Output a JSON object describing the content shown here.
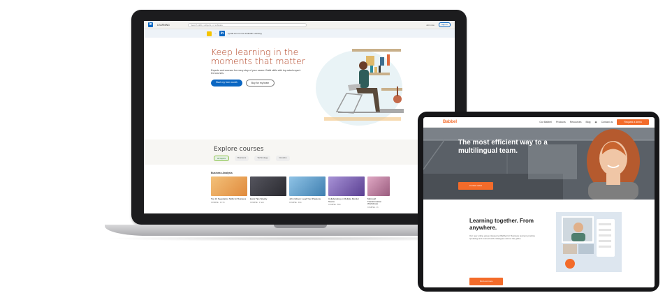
{
  "laptop": {
    "site": {
      "brand": "LEARNING",
      "search_placeholder": "Search skills, subjects, or software",
      "signin": "Sign in",
      "join_now": "Join now",
      "banner": "Lynda.com is now LinkedIn Learning"
    },
    "hero": {
      "headline": "Keep learning in the moments that matter",
      "sub": "Experts and courses for every step of your career. Build skills with top-rated expert-led courses.",
      "primary_btn": "Start my free month",
      "secondary_btn": "Buy for my team"
    },
    "explore": {
      "title": "Explore courses",
      "tabs": [
        "All topics",
        "Business",
        "Technology",
        "Creative"
      ],
      "section": "Business Analysis",
      "cards": [
        {
          "title": "Top 10 Negotiation Skills for Business",
          "meta": "COURSE · 1h 7m",
          "color": "#e08a3c"
        },
        {
          "title": "Excel Tips Weekly",
          "meta": "COURSE · 1 hour",
          "color": "#3d3d45"
        },
        {
          "title": "John Gibson: Lead Your Passions",
          "meta": "COURSE · 40m",
          "color": "#4f8fbf"
        },
        {
          "title": "Collaborating on Multiple Monitor Teams",
          "meta": "COURSE · 58m",
          "color": "#6b4fa0"
        },
        {
          "title": "Microsoft Transformation Workshops",
          "meta": "COURSE · 1h",
          "color": "#b06a8e"
        }
      ]
    }
  },
  "tablet": {
    "site": {
      "logo": "Babbel",
      "nav": [
        "Our Babbel",
        "Products",
        "Resources",
        "Blog",
        "Contact us"
      ],
      "cta": "Request a demo"
    },
    "hero": {
      "title": "The most efficient way to a multilingual team.",
      "cta": "Contact sales"
    },
    "lower": {
      "title": "Learning together. From anywhere.",
      "text": "Our new online group classes let Babbel for Business learners practice speaking and connect with colleagues across the globe.",
      "btn": "Find out more"
    },
    "colors": {
      "accent": "#f36b2a",
      "linkedin": "#0a66c2",
      "headline": "#b24020"
    }
  }
}
